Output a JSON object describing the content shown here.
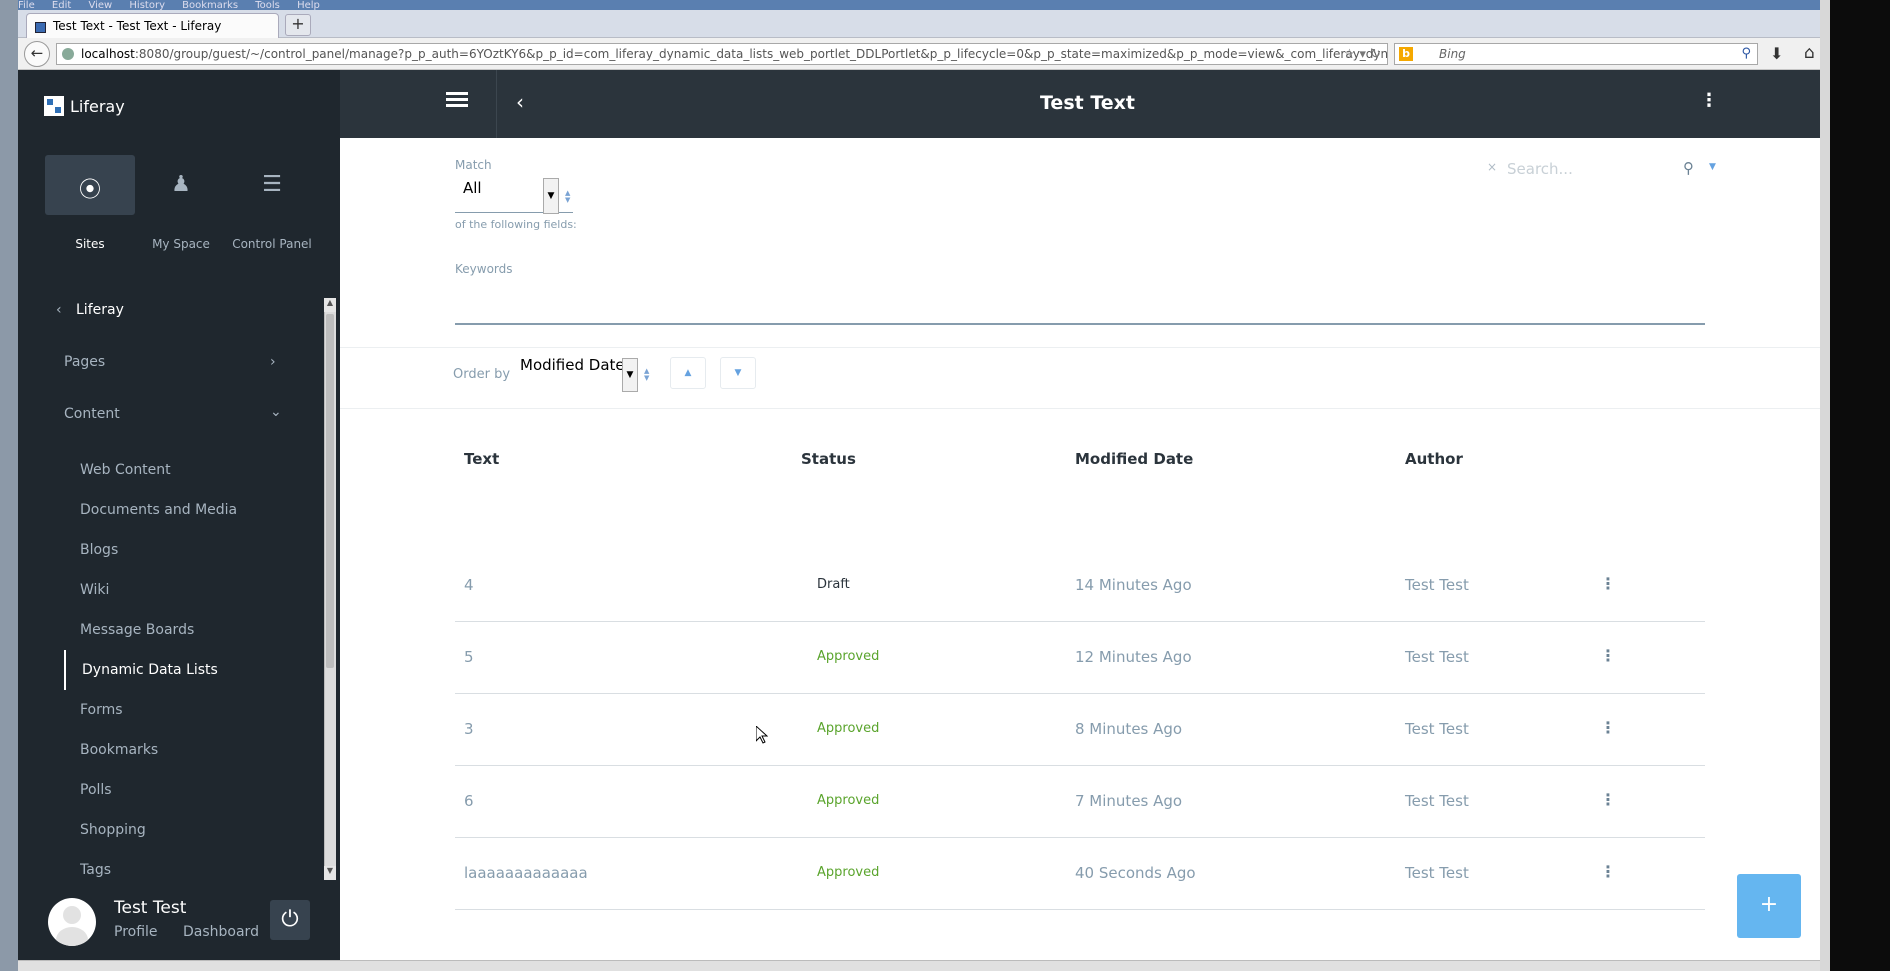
{
  "browser": {
    "menu": [
      "File",
      "Edit",
      "View",
      "History",
      "Bookmarks",
      "Tools",
      "Help"
    ],
    "tab_title": "Test Text - Test Text - Liferay",
    "new_tab": "+",
    "url_host": "localhost",
    "url_rest": ":8080/group/guest/~/control_panel/manage?p_p_auth=6YOztKY6&p_p_id=com_liferay_dynamic_data_lists_web_portlet_DDLPortlet&p_p_lifecycle=0&p_p_state=maximized&p_p_mode=view&_com_liferay_dynamic_data_list",
    "search_engine": "Bing"
  },
  "sidebar": {
    "brand": "Liferay",
    "product_menu": [
      {
        "label": "Sites",
        "icon": "compass-icon"
      },
      {
        "label": "My Space",
        "icon": "user-icon"
      },
      {
        "label": "Control Panel",
        "icon": "server-icon"
      }
    ],
    "site_name": "Liferay",
    "pages_label": "Pages",
    "content_label": "Content",
    "content_items": [
      "Web Content",
      "Documents and Media",
      "Blogs",
      "Wiki",
      "Message Boards",
      "Dynamic Data Lists",
      "Forms",
      "Bookmarks",
      "Polls",
      "Shopping",
      "Tags"
    ],
    "active_item": "Dynamic Data Lists",
    "user": {
      "name": "Test Test",
      "profile": "Profile",
      "dashboard": "Dashboard"
    }
  },
  "header": {
    "title": "Test Text"
  },
  "filter": {
    "match_label": "Match",
    "match_value": "All",
    "match_suffix": "of the following fields:",
    "keywords_label": "Keywords",
    "search_placeholder": "Search...",
    "search_clear": "×"
  },
  "order": {
    "label": "Order by",
    "value": "Modified Date"
  },
  "table": {
    "headers": [
      "Text",
      "Status",
      "Modified Date",
      "Author"
    ],
    "rows": [
      {
        "text": "4",
        "status": "Draft",
        "modified": "14 Minutes Ago",
        "author": "Test Test"
      },
      {
        "text": "5",
        "status": "Approved",
        "modified": "12 Minutes Ago",
        "author": "Test Test"
      },
      {
        "text": "3",
        "status": "Approved",
        "modified": "8 Minutes Ago",
        "author": "Test Test"
      },
      {
        "text": "6",
        "status": "Approved",
        "modified": "7 Minutes Ago",
        "author": "Test Test"
      },
      {
        "text": "laaaaaaaaaaaaa",
        "status": "Approved",
        "modified": "40 Seconds Ago",
        "author": "Test Test"
      }
    ]
  },
  "fab_label": "+",
  "colors": {
    "sidebar": "#1f272e",
    "topbar": "#2b343c",
    "accent": "#65b6f0",
    "approved": "#5aa42c",
    "muted": "#869cad"
  }
}
